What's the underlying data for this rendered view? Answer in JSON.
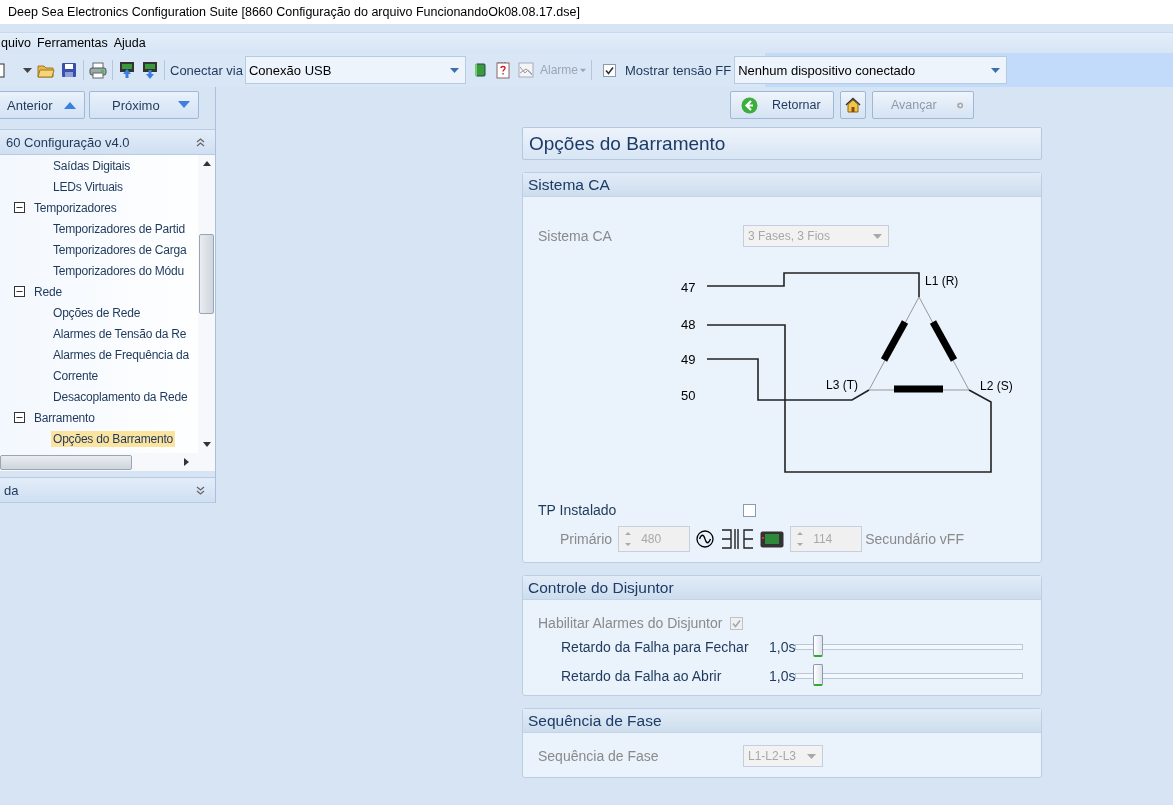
{
  "window": {
    "title": "Deep Sea Electronics Configuration Suite [8660 Configuração do arquivo FuncionandoOk08.08.17.dse]"
  },
  "menu": [
    "quivo",
    "Ferramentas",
    "Ajuda"
  ],
  "toolbar": {
    "connect_label": "Conectar via",
    "connection": "Conexão USB",
    "alarm": {
      "label": "Alarme",
      "disabled": true
    },
    "show_ff": {
      "label": "Mostrar tensão FF",
      "checked": true
    },
    "device": "Nenhum dispositivo conectado"
  },
  "nav": {
    "previous": "Anterior",
    "next": "Próximo"
  },
  "sidebar": {
    "header": "60 Configuração v4.0",
    "items": [
      {
        "children": [
          {
            "label": "Saídas Digitais",
            "selected": false
          },
          {
            "label": "LEDs Virtuais",
            "selected": false
          }
        ]
      },
      {
        "label": "Temporizadores",
        "expanded": true,
        "selected": false,
        "children": [
          {
            "label": "Temporizadores de Partid",
            "selected": false
          },
          {
            "label": "Temporizadores de Carga",
            "selected": false
          },
          {
            "label": "Temporizadores do Módu",
            "selected": false
          }
        ]
      },
      {
        "label": "Rede",
        "expanded": true,
        "selected": false,
        "children": [
          {
            "label": "Opções de Rede",
            "selected": false
          },
          {
            "label": "Alarmes de Tensão da Re",
            "selected": false
          },
          {
            "label": "Alarmes de Frequência da",
            "selected": false
          },
          {
            "label": "Corrente",
            "selected": false
          },
          {
            "label": "Desacoplamento da Rede",
            "selected": false
          }
        ]
      },
      {
        "label": "Barramento",
        "expanded": true,
        "selected": false,
        "children": [
          {
            "label": "Opções do Barramento",
            "selected": true
          }
        ]
      }
    ],
    "footer": "da"
  },
  "page_nav": {
    "back": "Retornar",
    "forward": {
      "label": "Avançar",
      "disabled": true
    }
  },
  "page_title": "Opções do Barramento",
  "ac_section": {
    "title": "Sistema CA",
    "system": {
      "label": "Sistema CA",
      "value": "3 Fases, 3 Fios",
      "disabled": true
    },
    "diagram": {
      "terminals": [
        "47",
        "48",
        "49",
        "50"
      ],
      "phases": [
        "L1 (R)",
        "L2 (S)",
        "L3 (T)"
      ]
    },
    "vt_installed": {
      "label": "TP Instalado",
      "checked": false
    },
    "primary": {
      "label": "Primário",
      "value": "480",
      "disabled": true
    },
    "secondary": {
      "label": "Secundário vFF",
      "value": "114",
      "disabled": true
    }
  },
  "breaker_section": {
    "title": "Controle do Disjuntor",
    "enable": {
      "label": "Habilitar Alarmes do Disjuntor",
      "checked": true,
      "disabled": true
    },
    "delays": [
      {
        "label": "Retardo da Falha para Fechar",
        "reading": "1,0s",
        "level": 0.1
      },
      {
        "label": "Retardo da Falha ao Abrir",
        "reading": "1,0s",
        "level": 0.1
      }
    ]
  },
  "phase_section": {
    "title": "Sequência de Fase",
    "label": "Sequência de Fase",
    "value": "L1-L2-L3",
    "disabled": true
  }
}
